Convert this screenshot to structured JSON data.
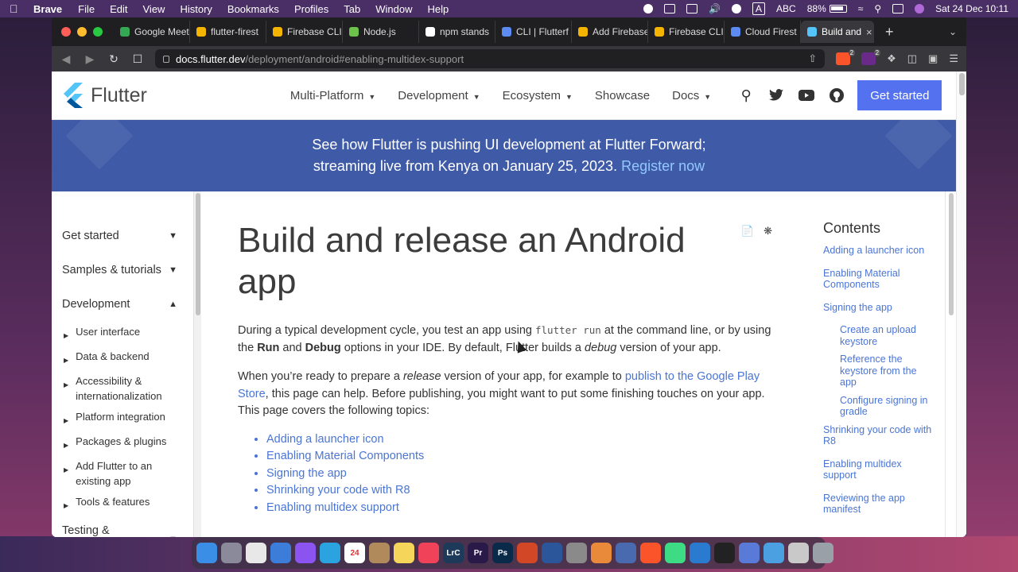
{
  "menubar": {
    "app_name": "Brave",
    "items": [
      "File",
      "Edit",
      "View",
      "History",
      "Bookmarks",
      "Profiles",
      "Tab",
      "Window",
      "Help"
    ],
    "input_source": "ABC",
    "battery": "88%",
    "datetime": "Sat 24 Dec  10:11"
  },
  "tabs": [
    {
      "label": "Google Meet",
      "color": "#34a853"
    },
    {
      "label": "flutter-firest",
      "color": "#f5b400"
    },
    {
      "label": "Firebase CLI",
      "color": "#f5b400"
    },
    {
      "label": "Node.js",
      "color": "#6cc24a"
    },
    {
      "label": "npm stands",
      "color": "#ffffff"
    },
    {
      "label": "CLI | Flutterf",
      "color": "#5d8bf4"
    },
    {
      "label": "Add Firebase",
      "color": "#f5b400"
    },
    {
      "label": "Firebase CLI",
      "color": "#f5b400"
    },
    {
      "label": "Cloud Firest",
      "color": "#5d8bf4"
    },
    {
      "label": "Build and",
      "color": "#54c5f8"
    }
  ],
  "address": {
    "domain": "docs.flutter.dev",
    "path": "/deployment/android#enabling-multidex-support",
    "badge_count": "2"
  },
  "header": {
    "logo_text": "Flutter",
    "nav": [
      {
        "label": "Multi-Platform",
        "caret": true
      },
      {
        "label": "Development",
        "caret": true
      },
      {
        "label": "Ecosystem",
        "caret": true
      },
      {
        "label": "Showcase",
        "caret": false
      },
      {
        "label": "Docs",
        "caret": true
      }
    ],
    "cta": "Get started"
  },
  "banner": {
    "line1": "See how Flutter is pushing UI development at Flutter Forward;",
    "line2": "streaming live from Kenya on January 25, 2023.",
    "link": "Register now"
  },
  "sidebar": {
    "sections": [
      {
        "label": "Get started",
        "chevron": "down"
      },
      {
        "label": "Samples & tutorials",
        "chevron": "down"
      },
      {
        "label": "Development",
        "chevron": "up"
      }
    ],
    "sub_items": [
      "User interface",
      "Data & backend",
      "Accessibility & internationalization",
      "Platform integration",
      "Packages & plugins",
      "Add Flutter to an existing app",
      "Tools & features"
    ],
    "bottom_section": {
      "label": "Testing & debugging",
      "chevron": "down"
    }
  },
  "article": {
    "title": "Build and release an Android app",
    "p1": {
      "a": "During a typical development cycle, you test an app using ",
      "code": "flutter run",
      "b": " at the command line, or by using the ",
      "bold1": "Run",
      "c": " and ",
      "bold2": "Debug",
      "d": " options in your IDE. By default, Flutter builds a ",
      "em": "debug",
      "e": " version of your app."
    },
    "p2": {
      "a": "When you’re ready to prepare a ",
      "em": "release",
      "b": " version of your app, for example to ",
      "link": "publish to the Google Play Store",
      "c": ", this page can help. Before publishing, you might want to put some finishing touches on your app. This page covers the following topics:"
    },
    "topics": [
      "Adding a launcher icon",
      "Enabling Material Components",
      "Signing the app",
      "Shrinking your code with R8",
      "Enabling multidex support"
    ]
  },
  "toc": {
    "title": "Contents",
    "items": [
      {
        "label": "Adding a launcher icon",
        "sub": false
      },
      {
        "label": "Enabling Material Components",
        "sub": false
      },
      {
        "label": "Signing the app",
        "sub": false
      },
      {
        "label": "Create an upload keystore",
        "sub": true
      },
      {
        "label": "Reference the keystore from the app",
        "sub": true
      },
      {
        "label": "Configure signing in gradle",
        "sub": true
      },
      {
        "label": "Shrinking your code with R8",
        "sub": false
      },
      {
        "label": "Enabling multidex support",
        "sub": false
      },
      {
        "label": "Reviewing the app manifest",
        "sub": false
      }
    ]
  },
  "dock": {
    "apps": [
      {
        "name": "finder",
        "color": "#3a8ee6",
        "label": ""
      },
      {
        "name": "launchpad",
        "color": "#8a8a9a",
        "label": ""
      },
      {
        "name": "chrome",
        "color": "#e8e8e8",
        "label": ""
      },
      {
        "name": "safari",
        "color": "#3b7dd8",
        "label": ""
      },
      {
        "name": "messenger",
        "color": "#8b54f0",
        "label": ""
      },
      {
        "name": "telegram",
        "color": "#2aa3e0",
        "label": ""
      },
      {
        "name": "calendar",
        "color": "#ffffff",
        "label": "24"
      },
      {
        "name": "contacts",
        "color": "#b08a5a",
        "label": ""
      },
      {
        "name": "notes",
        "color": "#f5d65a",
        "label": ""
      },
      {
        "name": "music",
        "color": "#f0435a",
        "label": ""
      },
      {
        "name": "lightroom",
        "color": "#1e3a5a",
        "label": "LrC"
      },
      {
        "name": "premiere",
        "color": "#2a1a4a",
        "label": "Pr"
      },
      {
        "name": "photoshop",
        "color": "#0a2a4a",
        "label": "Ps"
      },
      {
        "name": "powerpoint",
        "color": "#d24726",
        "label": ""
      },
      {
        "name": "word",
        "color": "#2b579a",
        "label": ""
      },
      {
        "name": "settings",
        "color": "#8a8a8a",
        "label": ""
      },
      {
        "name": "pencil",
        "color": "#e88a3a",
        "label": ""
      },
      {
        "name": "screen",
        "color": "#4a6ab0",
        "label": ""
      },
      {
        "name": "brave",
        "color": "#fb542b",
        "label": ""
      },
      {
        "name": "android-studio",
        "color": "#3ddc84",
        "label": ""
      },
      {
        "name": "vscode",
        "color": "#2a7ad0",
        "label": ""
      },
      {
        "name": "terminal",
        "color": "#222222",
        "label": ""
      },
      {
        "name": "xcode",
        "color": "#5a7ad8",
        "label": ""
      },
      {
        "name": "preview",
        "color": "#4aa0e0",
        "label": ""
      },
      {
        "name": "archive",
        "color": "#c9c9c9",
        "label": ""
      },
      {
        "name": "trash",
        "color": "#9aa0a8",
        "label": ""
      }
    ]
  }
}
